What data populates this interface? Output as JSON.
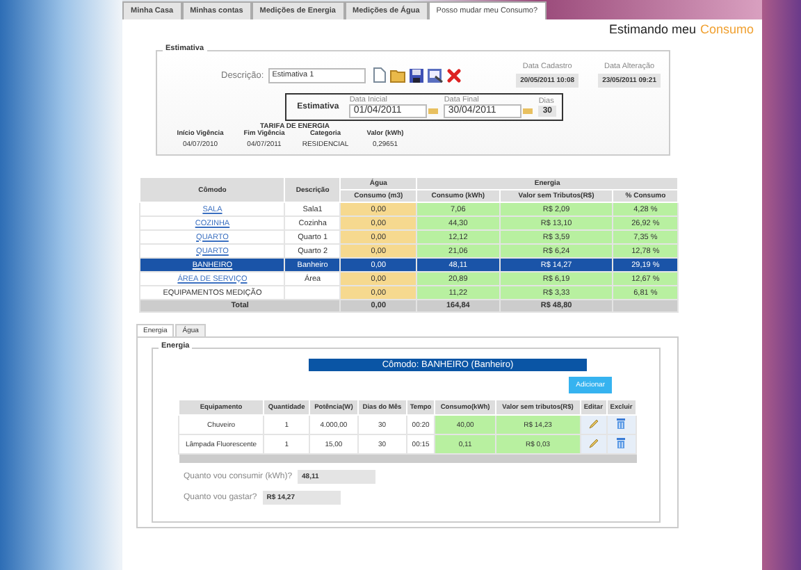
{
  "tabs": [
    {
      "label": "Minha Casa",
      "selected": false
    },
    {
      "label": "Minhas contas",
      "selected": false
    },
    {
      "label": "Medições de Energia",
      "selected": false
    },
    {
      "label": "Medições de Água",
      "selected": false
    },
    {
      "label": "Posso mudar meu Consumo?",
      "selected": true
    }
  ],
  "header": {
    "title": "Estimando meu",
    "title_accent": "Consumo"
  },
  "estimate": {
    "legend": "Estimativa",
    "description_label": "Descrição:",
    "description_value": "Estimativa 1",
    "created_label": "Data Cadastro",
    "created_value": "20/05/2011 10:08",
    "modified_label": "Data Alteração",
    "modified_value": "23/05/2011 09:21",
    "period": {
      "label": "Estimativa",
      "start_label": "Data Inicial",
      "start_value": "01/04/2011",
      "end_label": "Data Final",
      "end_value": "30/04/2011",
      "days_label": "Dias",
      "days_value": "30"
    },
    "tariff": {
      "title": "TARIFA DE ENERGIA",
      "columns": [
        "Início Vigência",
        "Fim Vigência",
        "Categoria",
        "Valor (kWh)"
      ],
      "row": [
        "04/07/2010",
        "04/07/2011",
        "RESIDENCIAL",
        "0,29651"
      ]
    }
  },
  "rooms": {
    "columns": [
      "Cômodo",
      "Descrição"
    ],
    "water_group": "Água",
    "water_columns": [
      "Consumo (m3)"
    ],
    "energy_group": "Energia",
    "energy_columns": [
      "Consumo (kWh)",
      "Valor sem Tributos(R$)",
      "% Consumo"
    ],
    "rows": [
      {
        "room": "SALA",
        "kind": "link",
        "description": "Sala1",
        "water": "0,00",
        "energy": "7,06",
        "value": "R$ 2,09",
        "percent": "4,28 %",
        "selected": false
      },
      {
        "room": "COZINHA",
        "kind": "link",
        "description": "Cozinha",
        "water": "0,00",
        "energy": "44,30",
        "value": "R$ 13,10",
        "percent": "26,92 %",
        "selected": false
      },
      {
        "room": "QUARTO",
        "kind": "link",
        "description": "Quarto 1",
        "water": "0,00",
        "energy": "12,12",
        "value": "R$ 3,59",
        "percent": "7,35 %",
        "selected": false
      },
      {
        "room": "QUARTO",
        "kind": "link",
        "description": "Quarto 2",
        "water": "0,00",
        "energy": "21,06",
        "value": "R$ 6,24",
        "percent": "12,78 %",
        "selected": false
      },
      {
        "room": "BANHEIRO",
        "kind": "link",
        "description": "Banheiro",
        "water": "0,00",
        "energy": "48,11",
        "value": "R$ 14,27",
        "percent": "29,19 %",
        "selected": true
      },
      {
        "room": "ÁREA DE SERVIÇO",
        "kind": "link",
        "description": "Área",
        "water": "0,00",
        "energy": "20,89",
        "value": "R$ 6,19",
        "percent": "12,67 %",
        "selected": false
      },
      {
        "room": "EQUIPAMENTOS MEDIÇÃO",
        "kind": "text",
        "water": "0,00",
        "energy": "11,22",
        "value": "R$ 3,33",
        "percent": "6,81 %",
        "selected": false
      }
    ],
    "total": {
      "label": "Total",
      "water": "0,00",
      "energy": "164,84",
      "value": "R$ 48,80"
    }
  },
  "detail": {
    "tabs": [
      {
        "label": "Energia",
        "selected": true
      },
      {
        "label": "Água",
        "selected": false
      }
    ],
    "legend": "Energia",
    "banner": "Cômodo: BANHEIRO (Banheiro)",
    "add_button": "Adicionar",
    "columns": [
      "Equipamento",
      "Quantidade",
      "Potência(W)",
      "Dias do Mês",
      "Tempo",
      "Consumo(kWh)",
      "Valor sem tributos(R$)",
      "Editar",
      "Excluir"
    ],
    "rows": [
      [
        "Chuveiro",
        "1",
        "4.000,00",
        "30",
        "00:20",
        "40,00",
        "R$ 14,23"
      ],
      [
        "Lâmpada Fluorescente",
        "1",
        "15,00",
        "30",
        "00:15",
        "0,11",
        "R$ 0,03"
      ]
    ],
    "consumption_label": "Quanto vou consumir (kWh)?",
    "consumption_value": "48,11",
    "cost_label": "Quanto vou gastar?",
    "cost_value": "R$ 14,27"
  }
}
